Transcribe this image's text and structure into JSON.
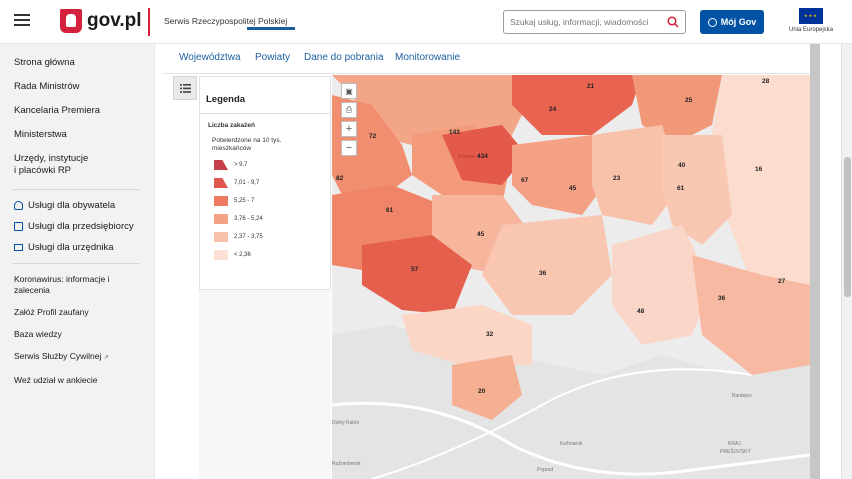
{
  "header": {
    "logo_text": "gov.pl",
    "service_title": "Serwis Rzeczypospolitej Polskiej",
    "search_placeholder": "Szukaj usług, informacji, wiadomości",
    "moj_gov_label": "Mój Gov",
    "eu_label": "Unia Europejska"
  },
  "sidebar": {
    "primary": [
      "Strona główna",
      "Rada Ministrów",
      "Kancelaria Premiera",
      "Ministerstwa",
      "Urzędy, instytucje",
      "i placówki RP"
    ],
    "services": [
      "Usługi dla obywatela",
      "Usługi dla przedsiębiorcy",
      "Usługi dla urzędnika"
    ],
    "links": [
      "Koronawirus: informacje i",
      "zalecenia",
      "Załóż Profil zaufany",
      "Baza wiedzy",
      "Serwis Służby Cywilnej",
      "Weź udział w ankiecie"
    ]
  },
  "tabs": [
    {
      "label": "Województwa"
    },
    {
      "label": "Powiaty"
    },
    {
      "label": "Dane do pobrania"
    },
    {
      "label": "Monitorowanie"
    }
  ],
  "legend": {
    "title": "Legenda",
    "subtitle": "Liczba zakażeń",
    "description": "Potwierdzone na 10 tys. mieszkańców",
    "items": [
      {
        "label": "> 9,7",
        "color": "#c6404b"
      },
      {
        "label": "7,01 - 9,7",
        "color": "#e0574f"
      },
      {
        "label": "5,25 - 7",
        "color": "#ee7a62"
      },
      {
        "label": "3,76 - 5,24",
        "color": "#f4a285"
      },
      {
        "label": "2,37 - 3,75",
        "color": "#f8c2aa"
      },
      {
        "label": "< 2,36",
        "color": "#fce0d4"
      }
    ]
  },
  "map": {
    "region_values": [
      "28",
      "21",
      "24",
      "25",
      "72",
      "143",
      "434",
      "67",
      "40",
      "16",
      "82",
      "45",
      "23",
      "61",
      "61",
      "45",
      "57",
      "36",
      "27",
      "48",
      "36",
      "32",
      "20"
    ],
    "place_labels": [
      "Kraków",
      "Bardejov",
      "Kežmarok",
      "Poprad",
      "KRAJ",
      "PREŠOVSKÝ",
      "Dolný Kubín",
      "Ružomberok"
    ]
  }
}
